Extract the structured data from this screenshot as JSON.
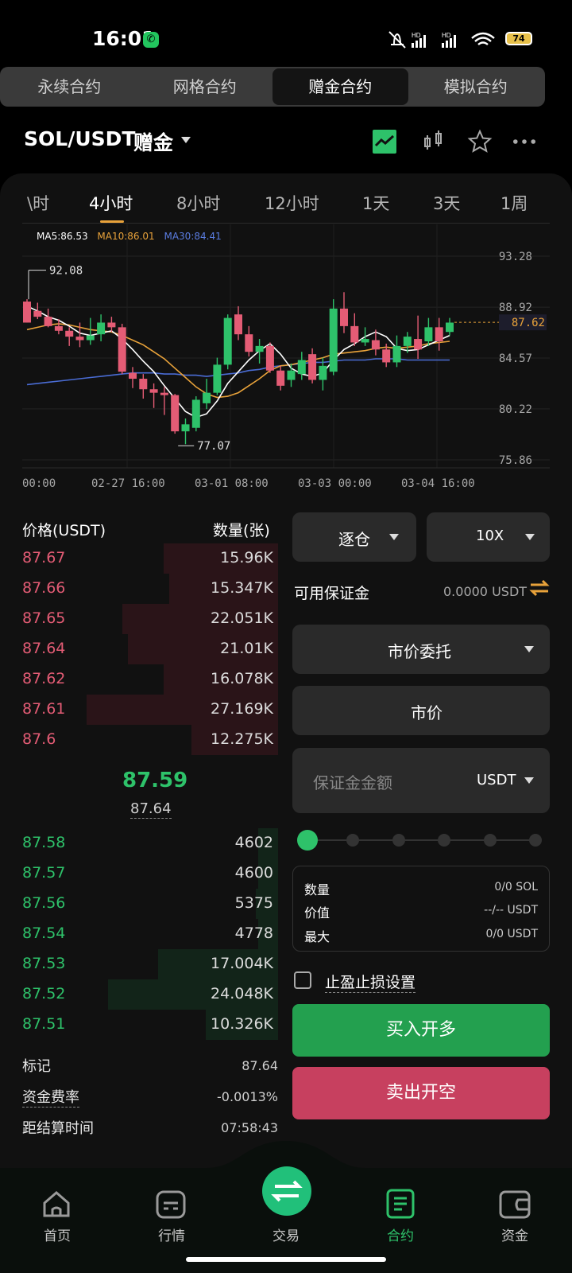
{
  "status_bar": {
    "time": "16:01",
    "battery": "74"
  },
  "top_tabs": [
    "永续合约",
    "网格合约",
    "赠金合约",
    "模拟合约"
  ],
  "top_tab_active": 2,
  "header": {
    "pair": "SOL/USDT",
    "mode": "赠金"
  },
  "intervals": [
    "\\时",
    "4小时",
    "8小时",
    "12小时",
    "1天",
    "3天",
    "1周"
  ],
  "interval_active": "4小时",
  "chart_data": {
    "type": "candlestick",
    "ma_legend": {
      "ma5": "MA5:86.53",
      "ma10": "MA10:86.01",
      "ma30": "MA30:84.41"
    },
    "y_ticks": [
      "93.28",
      "88.92",
      "84.57",
      "80.22",
      "75.86"
    ],
    "x_ticks": [
      "00:00",
      "02-27 16:00",
      "03-01 08:00",
      "03-03 00:00",
      "03-04 16:00"
    ],
    "high_label": "92.08",
    "low_label": "77.07",
    "last_price": "87.62",
    "ylim": [
      75.86,
      93.28
    ],
    "candles": [
      [
        89.4,
        89.6,
        87.6,
        87.6
      ],
      [
        88.6,
        89.3,
        87.9,
        88.1
      ],
      [
        88.1,
        88.8,
        87.2,
        87.3
      ],
      [
        87.3,
        87.9,
        86.6,
        86.9
      ],
      [
        86.9,
        87.2,
        85.6,
        86.4
      ],
      [
        86.4,
        87.6,
        85.5,
        86.1
      ],
      [
        86.1,
        88.0,
        85.7,
        86.5
      ],
      [
        86.6,
        88.3,
        86.0,
        87.6
      ],
      [
        87.6,
        88.1,
        86.8,
        87.2
      ],
      [
        87.2,
        87.5,
        83.2,
        83.4
      ],
      [
        83.3,
        83.8,
        82.0,
        82.8
      ],
      [
        82.8,
        83.2,
        81.1,
        81.9
      ],
      [
        81.9,
        82.4,
        80.3,
        81.6
      ],
      [
        81.6,
        82.1,
        79.7,
        81.4
      ],
      [
        81.4,
        81.5,
        78.1,
        78.3
      ],
      [
        78.3,
        79.4,
        77.2,
        78.9
      ],
      [
        78.6,
        81.3,
        78.3,
        81.0
      ],
      [
        80.7,
        82.8,
        80.2,
        81.6
      ],
      [
        81.6,
        84.6,
        81.4,
        84.0
      ],
      [
        84.0,
        88.3,
        83.6,
        88.0
      ],
      [
        88.3,
        89.0,
        86.1,
        86.6
      ],
      [
        86.6,
        87.3,
        84.7,
        85.1
      ],
      [
        85.1,
        86.2,
        84.1,
        85.6
      ],
      [
        85.6,
        85.9,
        83.3,
        83.5
      ],
      [
        83.5,
        83.9,
        81.8,
        82.2
      ],
      [
        82.7,
        84.1,
        82.1,
        83.5
      ],
      [
        83.2,
        85.1,
        82.7,
        84.4
      ],
      [
        84.9,
        85.4,
        82.4,
        82.7
      ],
      [
        82.7,
        84.6,
        81.8,
        83.9
      ],
      [
        83.4,
        89.6,
        83.1,
        88.8
      ],
      [
        88.8,
        90.2,
        86.7,
        87.3
      ],
      [
        87.3,
        88.4,
        85.6,
        85.9
      ],
      [
        85.9,
        87.2,
        85.6,
        86.2
      ],
      [
        86.1,
        87.0,
        84.8,
        85.3
      ],
      [
        85.3,
        85.8,
        83.8,
        84.2
      ],
      [
        84.2,
        86.5,
        83.8,
        85.6
      ],
      [
        85.6,
        86.8,
        85.0,
        86.4
      ],
      [
        86.2,
        88.2,
        84.5,
        85.3
      ],
      [
        86.0,
        88.0,
        85.6,
        87.2
      ],
      [
        87.2,
        88.0,
        85.2,
        86.0
      ],
      [
        86.8,
        88.0,
        86.5,
        87.6
      ]
    ],
    "ma5": [
      89.0,
      88.6,
      88.1,
      87.8,
      87.3,
      86.7,
      86.5,
      86.7,
      86.9,
      86.2,
      85.3,
      84.3,
      83.4,
      82.2,
      81.1,
      80.0,
      79.5,
      79.8,
      80.9,
      82.4,
      83.4,
      84.4,
      85.2,
      85.8,
      84.9,
      83.7,
      83.2,
      83.0,
      83.3,
      84.4,
      85.3,
      85.8,
      86.4,
      86.8,
      86.4,
      85.4,
      85.2,
      85.3,
      85.7,
      86.1,
      86.5
    ],
    "ma10": [
      87.0,
      87.2,
      87.4,
      87.5,
      87.4,
      87.2,
      87.0,
      86.9,
      86.8,
      86.5,
      86.1,
      85.7,
      85.1,
      84.5,
      83.7,
      82.9,
      82.1,
      81.5,
      81.2,
      81.3,
      81.6,
      82.2,
      82.8,
      83.5,
      83.9,
      84.0,
      84.2,
      84.4,
      84.6,
      84.9,
      85.0,
      85.1,
      85.2,
      85.4,
      85.5,
      85.4,
      85.5,
      85.6,
      85.8,
      85.9,
      86.0
    ],
    "ma30": [
      82.3,
      82.4,
      82.5,
      82.6,
      82.7,
      82.8,
      82.9,
      83.0,
      83.1,
      83.2,
      83.3,
      83.3,
      83.3,
      83.2,
      83.2,
      83.1,
      83.1,
      83.0,
      83.1,
      83.2,
      83.3,
      83.5,
      83.6,
      83.8,
      83.9,
      84.0,
      84.1,
      84.2,
      84.2,
      84.3,
      84.4,
      84.4,
      84.4,
      84.5,
      84.5,
      84.5,
      84.4,
      84.4,
      84.4,
      84.4,
      84.4
    ]
  },
  "orderbook": {
    "price_header": "价格(USDT)",
    "qty_header": "数量(张)",
    "asks": [
      {
        "price": "87.67",
        "qty": "15.96K",
        "depth": 0.41
      },
      {
        "price": "87.66",
        "qty": "15.347K",
        "depth": 0.39
      },
      {
        "price": "87.65",
        "qty": "22.051K",
        "depth": 0.56
      },
      {
        "price": "87.64",
        "qty": "21.01K",
        "depth": 0.54
      },
      {
        "price": "87.62",
        "qty": "16.078K",
        "depth": 0.41
      },
      {
        "price": "87.61",
        "qty": "27.169K",
        "depth": 0.69
      },
      {
        "price": "87.6",
        "qty": "12.275K",
        "depth": 0.31
      }
    ],
    "last_price": "87.59",
    "mark_price": "87.64",
    "bids": [
      {
        "price": "87.58",
        "qty": "4602",
        "depth": 0.07
      },
      {
        "price": "87.57",
        "qty": "4600",
        "depth": 0.07
      },
      {
        "price": "87.56",
        "qty": "5375",
        "depth": 0.08
      },
      {
        "price": "87.54",
        "qty": "4778",
        "depth": 0.07
      },
      {
        "price": "87.53",
        "qty": "17.004K",
        "depth": 0.43
      },
      {
        "price": "87.52",
        "qty": "24.048K",
        "depth": 0.61
      },
      {
        "price": "87.51",
        "qty": "10.326K",
        "depth": 0.26
      }
    ]
  },
  "stats": [
    {
      "label": "标记",
      "value": "87.64"
    },
    {
      "label": "资金费率",
      "value": "-0.0013%"
    },
    {
      "label": "距结算时间",
      "value": "07:58:43"
    }
  ],
  "form": {
    "margin_mode": "逐仓",
    "leverage": "10X",
    "avail_label": "可用保证金",
    "avail_value": "0.0000 USDT",
    "order_type": "市价委托",
    "price_field": "市价",
    "amount_placeholder": "保证金金额",
    "amount_unit": "USDT",
    "info": [
      {
        "label": "数量",
        "value": "0/0 SOL"
      },
      {
        "label": "价值",
        "value": "--/-- USDT"
      },
      {
        "label": "最大",
        "value": "0/0 USDT"
      }
    ],
    "tpsl_label": "止盈止损设置",
    "buy_label": "买入开多",
    "sell_label": "卖出开空"
  },
  "nav": {
    "items": [
      "首页",
      "行情",
      "交易",
      "合约",
      "资金"
    ],
    "active": "合约"
  },
  "colors": {
    "up": "#2ec26a",
    "down": "#e45c75",
    "ma5": "#ffffff",
    "ma10": "#e8a23a",
    "ma30": "#4a6cd4"
  }
}
